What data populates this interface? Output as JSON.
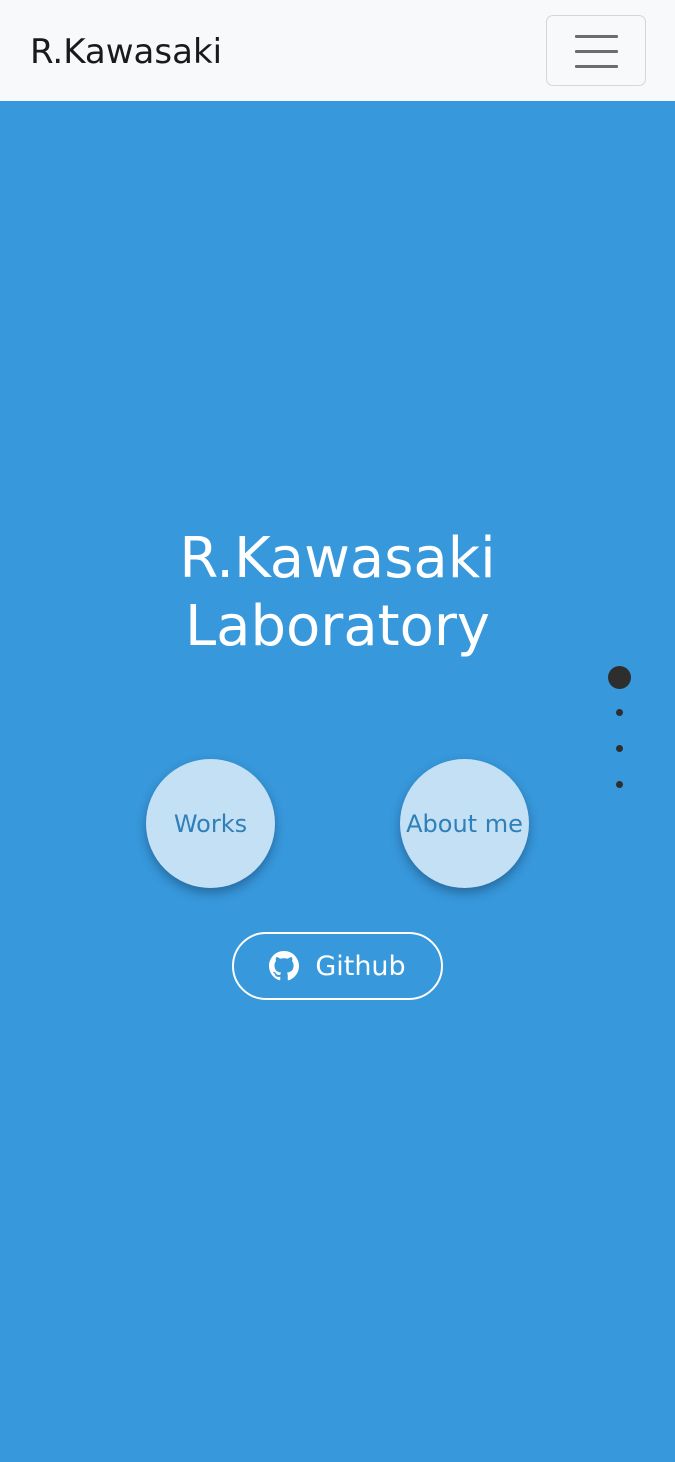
{
  "navbar": {
    "brand": "R.Kawasaki",
    "toggler_icon": "hamburger-menu-icon"
  },
  "hero": {
    "title_line1": "R.Kawasaki",
    "title_line2": "Laboratory"
  },
  "buttons": {
    "works_label": "Works",
    "about_label": "About me",
    "github_label": "Github",
    "github_icon": "github-icon"
  },
  "section_nav": {
    "count": 4,
    "active_index": 0
  },
  "colors": {
    "background": "#3798db",
    "navbar": "#f8f9fa",
    "circle_button": "#c3e0f4",
    "circle_text": "#2f7fb8",
    "dot": "#2e2e2e"
  }
}
